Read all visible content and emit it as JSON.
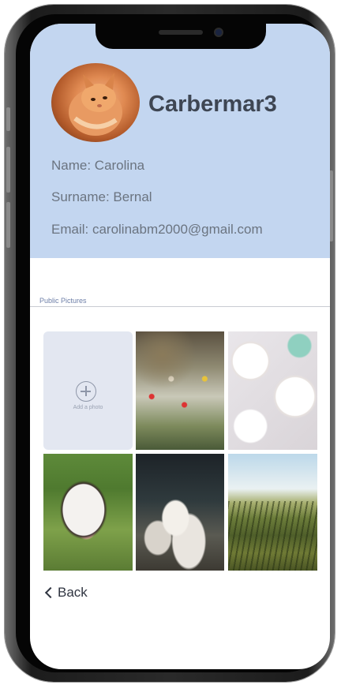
{
  "profile": {
    "username": "Carbermar3",
    "name_line": "Name: Carolina",
    "surname_line": "Surname: Bernal",
    "email_line": "Email: carolinabm2000@gmail.com"
  },
  "section": {
    "label": "Public Pictures"
  },
  "grid": {
    "add_photo_label": "Add a photo",
    "photos": [
      {
        "subject": "wildflowers"
      },
      {
        "subject": "desserts-on-plates"
      },
      {
        "subject": "cow"
      },
      {
        "subject": "geese"
      },
      {
        "subject": "crop-field"
      }
    ]
  },
  "nav": {
    "back_label": "Back"
  },
  "colors": {
    "header_bg": "#c3d6f0",
    "add_tile_bg": "#e3e7f1",
    "username_text": "#3e4653",
    "info_text": "#6b7480"
  },
  "icons": {
    "avatar": "cat-avatar",
    "add": "plus-circle-icon",
    "back": "chevron-left-icon"
  }
}
